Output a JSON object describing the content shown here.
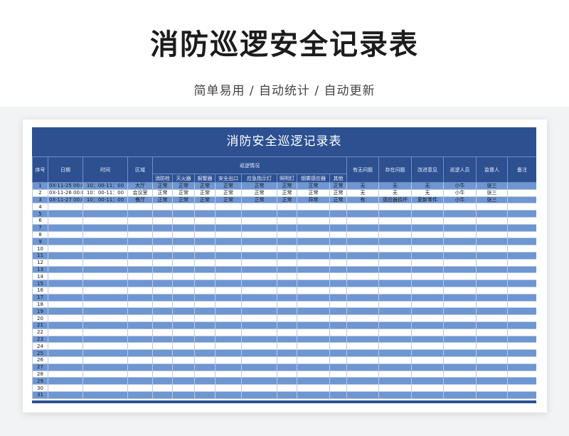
{
  "page": {
    "title": "消防巡逻安全记录表",
    "subtitle": "简单易用 / 自动统计 / 自动更新"
  },
  "sheet": {
    "title": "消防安全巡逻记录表",
    "headers": {
      "seq": "序号",
      "date": "日期",
      "time": "时间",
      "area": "区域",
      "patrol_group": "巡逻情况",
      "patrol_items": [
        "消防栓",
        "灭火器",
        "报警器",
        "安全出口",
        "应急指示灯",
        "照明灯",
        "烟雾感应器",
        "其他"
      ],
      "has_issue": "有无问题",
      "issue": "存在问题",
      "suggestion": "改进意见",
      "patroller": "巡逻人员",
      "supervisor": "监督人",
      "remark": "备注"
    },
    "records": [
      {
        "seq": "1",
        "date": "0X-11-25 00:00",
        "time": "10：00-11：00",
        "area": "大厅",
        "checks": [
          "正常",
          "正常",
          "正常",
          "正常",
          "正常",
          "正常",
          "正常",
          "正常"
        ],
        "has_issue": "无",
        "issue": "无",
        "suggestion": "无",
        "patroller": "小牛",
        "supervisor": "张三",
        "remark": ""
      },
      {
        "seq": "2",
        "date": "0X-11-26 00:00",
        "time": "10：00-11：00",
        "area": "会议室",
        "checks": [
          "正常",
          "正常",
          "正常",
          "正常",
          "正常",
          "正常",
          "正常",
          "正常"
        ],
        "has_issue": "无",
        "issue": "无",
        "suggestion": "无",
        "patroller": "小牛",
        "supervisor": "张三",
        "remark": ""
      },
      {
        "seq": "3",
        "date": "0X-11-27 00:00",
        "time": "10：00-11：00",
        "area": "餐厅",
        "checks": [
          "正常",
          "正常",
          "正常",
          "正常",
          "正常",
          "正常",
          "异常",
          "正常"
        ],
        "has_issue": "有",
        "issue": "感应器损坏",
        "suggestion": "更新零件",
        "patroller": "小牛",
        "supervisor": "张三",
        "remark": ""
      }
    ],
    "empty_row_numbers": [
      "4",
      "5",
      "6",
      "7",
      "8",
      "9",
      "10",
      "11",
      "12",
      "13",
      "14",
      "15",
      "16",
      "17",
      "18",
      "19",
      "20",
      "21",
      "22",
      "23",
      "24",
      "25",
      "26",
      "27",
      "28",
      "29",
      "30",
      "31"
    ],
    "colors": {
      "header": "#2d5091",
      "band_row": "#6e96d1",
      "plain_row": "#ffffff"
    }
  }
}
